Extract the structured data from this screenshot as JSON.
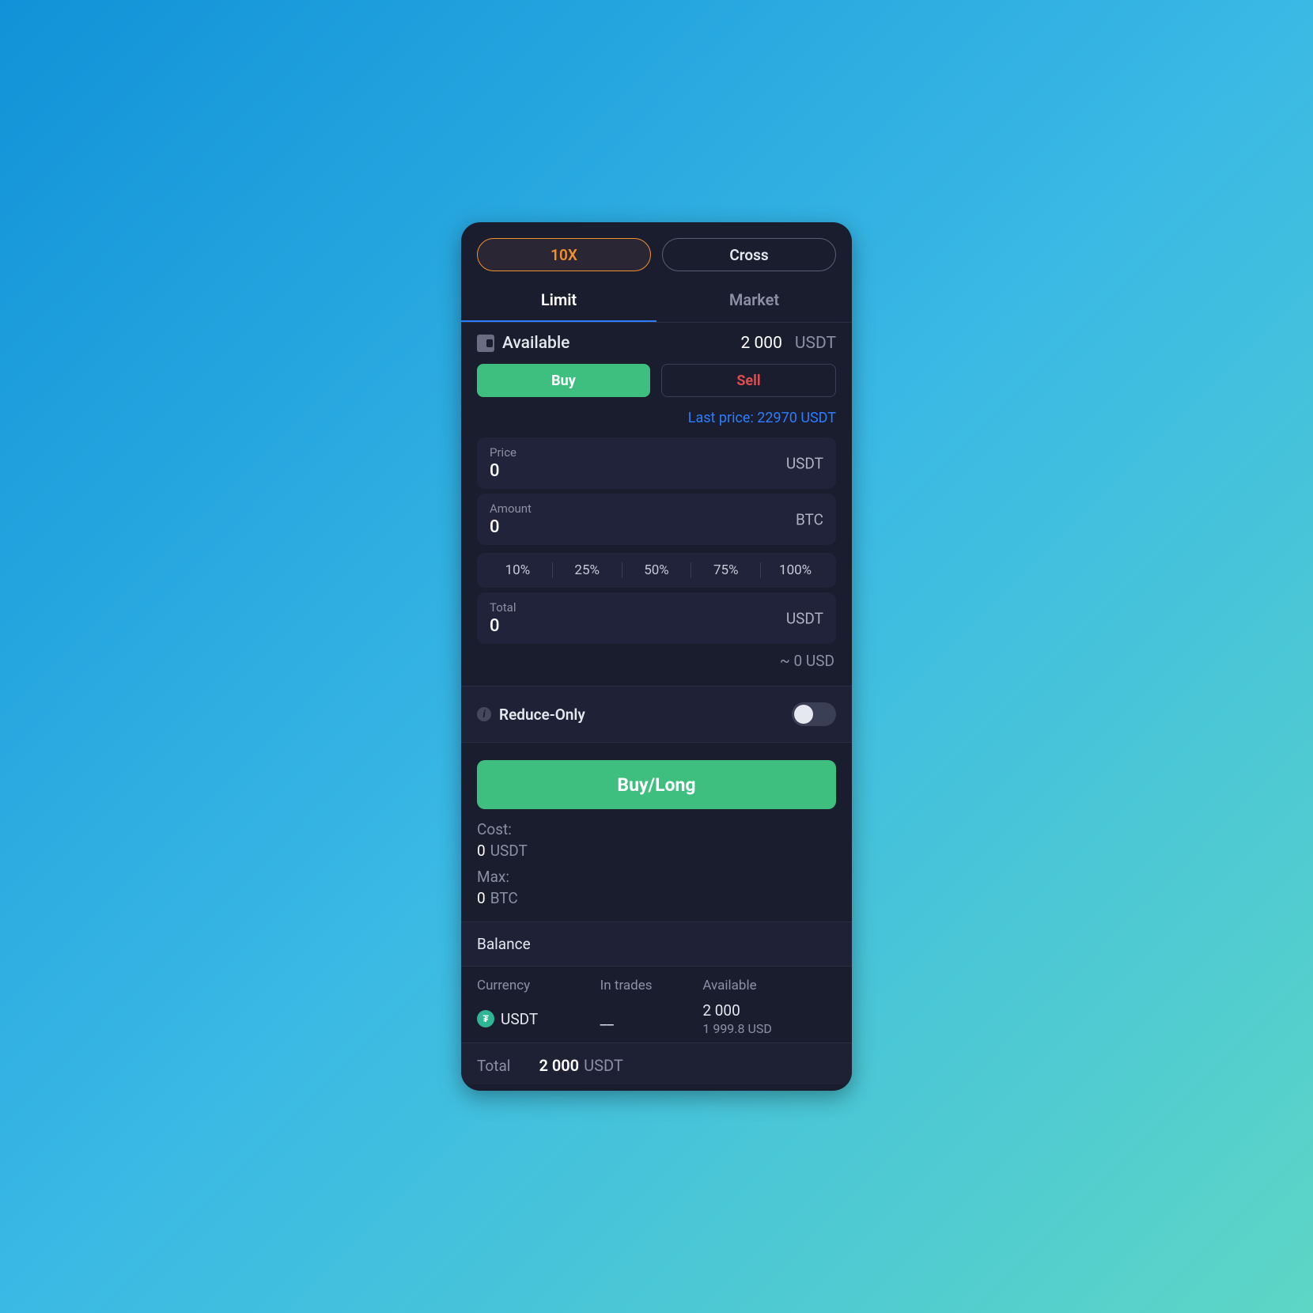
{
  "header": {
    "leverage_label": "10X",
    "mode_label": "Cross",
    "tabs": {
      "limit": "Limit",
      "market": "Market"
    }
  },
  "available": {
    "label": "Available",
    "amount": "2 000",
    "unit": "USDT"
  },
  "side": {
    "buy_label": "Buy",
    "sell_label": "Sell"
  },
  "last_price": {
    "text": "Last price: 22970 USDT"
  },
  "fields": {
    "price": {
      "label": "Price",
      "value": "0",
      "unit": "USDT"
    },
    "amount": {
      "label": "Amount",
      "value": "0",
      "unit": "BTC"
    },
    "total": {
      "label": "Total",
      "value": "0",
      "unit": "USDT"
    }
  },
  "percent_presets": [
    "10%",
    "25%",
    "50%",
    "75%",
    "100%"
  ],
  "approx_usd": "~ 0 USD",
  "reduce_only": {
    "label": "Reduce-Only",
    "enabled": false
  },
  "submit": {
    "label": "Buy/Long"
  },
  "meta": {
    "cost_label": "Cost:",
    "cost_value": "0",
    "cost_unit": "USDT",
    "max_label": "Max:",
    "max_value": "0",
    "max_unit": "BTC"
  },
  "balance": {
    "header": "Balance",
    "columns": {
      "currency": "Currency",
      "in_trades": "In trades",
      "available": "Available"
    },
    "row": {
      "symbol": "USDT",
      "in_trades": "__",
      "available": "2 000",
      "available_usd": "1 999.8 USD"
    },
    "total_label": "Total",
    "total_value": "2 000",
    "total_unit": "USDT"
  }
}
